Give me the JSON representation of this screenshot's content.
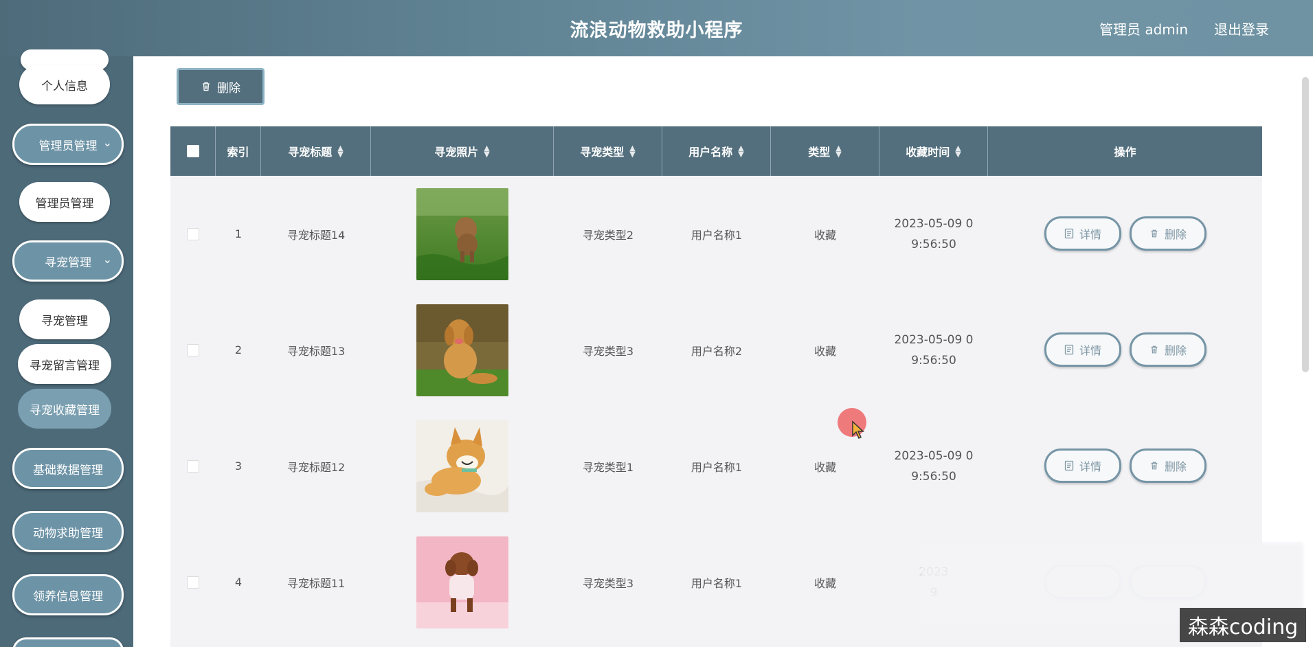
{
  "header": {
    "title": "流浪动物救助小程序",
    "user": "管理员 admin",
    "logout": "退出登录"
  },
  "sidebar": {
    "profile": "个人信息",
    "groups": [
      {
        "label": "管理员管理",
        "items": [
          "管理员管理"
        ]
      },
      {
        "label": "寻宠管理",
        "items": [
          "寻宠管理",
          "寻宠留言管理",
          "寻宠收藏管理"
        ]
      },
      {
        "label": "基础数据管理",
        "items": []
      },
      {
        "label": "动物求助管理",
        "items": []
      },
      {
        "label": "领养信息管理",
        "items": []
      }
    ],
    "active_item": "寻宠收藏管理"
  },
  "toolbar": {
    "delete_label": "删除"
  },
  "table": {
    "columns": [
      "索引",
      "寻宠标题",
      "寻宠照片",
      "寻宠类型",
      "用户名称",
      "类型",
      "收藏时间",
      "操作"
    ],
    "rows": [
      {
        "index": "1",
        "title": "寻宠标题14",
        "photo": "poodle-on-grass",
        "type": "寻宠类型2",
        "user": "用户名称1",
        "kind": "收藏",
        "time_l1": "2023-05-09 0",
        "time_l2": "9:56:50"
      },
      {
        "index": "2",
        "title": "寻宠标题13",
        "photo": "golden-retriever",
        "type": "寻宠类型3",
        "user": "用户名称2",
        "kind": "收藏",
        "time_l1": "2023-05-09 0",
        "time_l2": "9:56:50"
      },
      {
        "index": "3",
        "title": "寻宠标题12",
        "photo": "shiba-inu",
        "type": "寻宠类型1",
        "user": "用户名称1",
        "kind": "收藏",
        "time_l1": "2023-05-09 0",
        "time_l2": "9:56:50"
      },
      {
        "index": "4",
        "title": "寻宠标题11",
        "photo": "poodle-pink-background",
        "type": "寻宠类型3",
        "user": "用户名称1",
        "kind": "收藏",
        "time_l1": "2023",
        "time_l2": "9"
      }
    ],
    "detail_label": "详情",
    "delete_label": "删除"
  },
  "watermark": "森森coding",
  "colors": {
    "header": "#5f8293",
    "sidebar": "#4d6a79",
    "table_head": "#536f7d",
    "table_body": "#f3f3f6",
    "button_border": "#7595a6"
  }
}
